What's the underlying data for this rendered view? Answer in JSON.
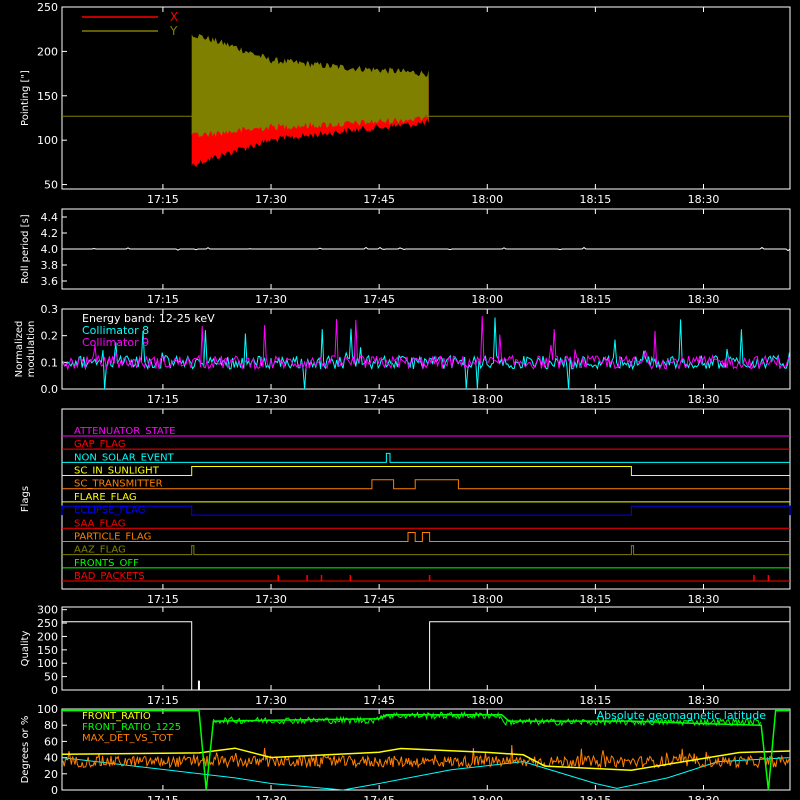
{
  "colors": {
    "background": "#000000",
    "axis": "#ffffff",
    "x_pointing": "#ff0000",
    "y_pointing": "#808000",
    "collimator8": "#00ffff",
    "collimator9": "#ff00ff",
    "quality": "#ffffff"
  },
  "chart_data": [
    {
      "type": "area",
      "ylabel": "Pointing [\"]",
      "xlim": [
        "17:01",
        "18:42"
      ],
      "ylim": [
        45,
        250
      ],
      "yticks": [
        50,
        100,
        150,
        200,
        250
      ],
      "xticks": [
        "17:15",
        "17:30",
        "17:45",
        "18:00",
        "18:15",
        "18:30"
      ],
      "legend_position": "top-left",
      "series": [
        {
          "name": "X",
          "color": "#ff0000",
          "baseline": 127,
          "start": "17:19",
          "end": "17:52",
          "envelope_time": [
            "17:19",
            "17:25",
            "17:30",
            "17:40",
            "17:52"
          ],
          "envelope_low": [
            72,
            88,
            100,
            110,
            120
          ],
          "envelope_high": [
            130,
            148,
            160,
            165,
            168
          ]
        },
        {
          "name": "Y",
          "color": "#808000",
          "baseline": 127,
          "start": "17:19",
          "end": "17:52",
          "envelope_time": [
            "17:19",
            "17:25",
            "17:30",
            "17:40",
            "17:52"
          ],
          "envelope_low": [
            105,
            110,
            115,
            118,
            125
          ],
          "envelope_high": [
            220,
            205,
            190,
            182,
            175
          ]
        }
      ]
    },
    {
      "type": "line",
      "ylabel": "Roll period [s]",
      "ylim": [
        3.5,
        4.5
      ],
      "yticks": [
        3.6,
        3.8,
        4.0,
        4.2,
        4.4
      ],
      "xticks": [
        "17:15",
        "17:30",
        "17:45",
        "18:00",
        "18:15",
        "18:30"
      ],
      "series": [
        {
          "name": "",
          "value": 4.0
        }
      ]
    },
    {
      "type": "line",
      "ylabel_lines": [
        "Normalized",
        "modulation"
      ],
      "ylim": [
        0,
        0.3
      ],
      "yticks": [
        0.0,
        0.1,
        0.2,
        0.3
      ],
      "xticks": [
        "17:15",
        "17:30",
        "17:45",
        "18:00",
        "18:15",
        "18:30"
      ],
      "annotation": "Energy band: 12-25 keV",
      "series": [
        {
          "name": "Collimator 8",
          "color": "#00ffff",
          "mean": 0.1
        },
        {
          "name": "Collimator 9",
          "color": "#ff00ff",
          "mean": 0.1
        }
      ]
    },
    {
      "type": "line",
      "ylabel": "Flags",
      "xticks": [
        "17:15",
        "17:30",
        "17:45",
        "18:00",
        "18:15",
        "18:30"
      ],
      "flags": [
        {
          "name": "ATTENUATOR_STATE",
          "color": "#ff00ff",
          "on": []
        },
        {
          "name": "GAP_FLAG",
          "color": "#ff0000",
          "on": []
        },
        {
          "name": "NON_SOLAR_EVENT",
          "color": "#00ffff",
          "on": [
            [
              "17:46",
              "17:46.5"
            ]
          ]
        },
        {
          "name": "SC_IN_SUNLIGHT",
          "color": "#ffff00",
          "on": [
            [
              "17:19",
              "18:20"
            ]
          ]
        },
        {
          "name": "SC_TRANSMITTER",
          "color": "#ff8000",
          "on": [
            [
              "17:44",
              "17:47"
            ],
            [
              "17:50",
              "17:56"
            ]
          ]
        },
        {
          "name": "FLARE_FLAG",
          "color": "#ffff00",
          "on": []
        },
        {
          "name": "ECLIPSE_FLAG",
          "color": "#0000ff",
          "on": [
            [
              "17:01",
              "17:19"
            ],
            [
              "18:20",
              "18:42"
            ]
          ]
        },
        {
          "name": "SAA_FLAG",
          "color": "#ff0000",
          "on": []
        },
        {
          "name": "PARTICLE_FLAG",
          "color": "#ff8000",
          "on": [
            [
              "17:49",
              "17:50"
            ],
            [
              "17:51",
              "17:52"
            ]
          ]
        },
        {
          "name": "AAZ_FLAG",
          "color": "#808000",
          "on": [
            [
              "17:19",
              "17:19.3"
            ],
            [
              "18:20",
              "18:20.3"
            ]
          ]
        },
        {
          "name": "FRONTS_OFF",
          "color": "#00ff00",
          "on": []
        },
        {
          "name": "BAD_PACKETS",
          "color": "#ff0000",
          "spikes": [
            "17:31",
            "17:35",
            "17:37",
            "17:41",
            "17:52",
            "18:37",
            "18:39"
          ]
        }
      ]
    },
    {
      "type": "line",
      "ylabel": "Quality",
      "ylim": [
        0,
        310
      ],
      "yticks": [
        0,
        50,
        100,
        150,
        200,
        250,
        300
      ],
      "xticks": [
        "17:15",
        "17:30",
        "17:45",
        "18:00",
        "18:15",
        "18:30"
      ],
      "series": [
        {
          "name": "",
          "segments": [
            {
              "from": "17:01",
              "to": "17:19",
              "value": 255
            },
            {
              "from": "17:19",
              "to": "17:52",
              "value": 0
            },
            {
              "from": "17:52",
              "to": "18:42",
              "value": 255
            }
          ]
        }
      ]
    },
    {
      "type": "line",
      "ylabel": "Degrees or %",
      "ylim": [
        0,
        100
      ],
      "yticks": [
        0,
        20,
        40,
        60,
        80,
        100
      ],
      "xticks": [
        "17:15",
        "17:30",
        "17:45",
        "18:00",
        "18:15",
        "18:30"
      ],
      "annotation": "Absolute geomagnetic latitude",
      "series": [
        {
          "name": "FRONT_RATIO",
          "color": "#ffff00"
        },
        {
          "name": "FRONT_RATIO_1225",
          "color": "#00ff00"
        },
        {
          "name": "MAX_DET_VS_TOT",
          "color": "#ff8000"
        },
        {
          "name": "Absolute geomagnetic latitude",
          "color": "#00ffff",
          "time": [
            "17:01",
            "17:25",
            "17:30",
            "17:40",
            "17:45",
            "17:55",
            "18:05",
            "18:15",
            "18:18",
            "18:25",
            "18:32",
            "18:42"
          ],
          "value": [
            40,
            15,
            8,
            0,
            8,
            25,
            35,
            8,
            2,
            15,
            35,
            40
          ]
        }
      ]
    }
  ]
}
